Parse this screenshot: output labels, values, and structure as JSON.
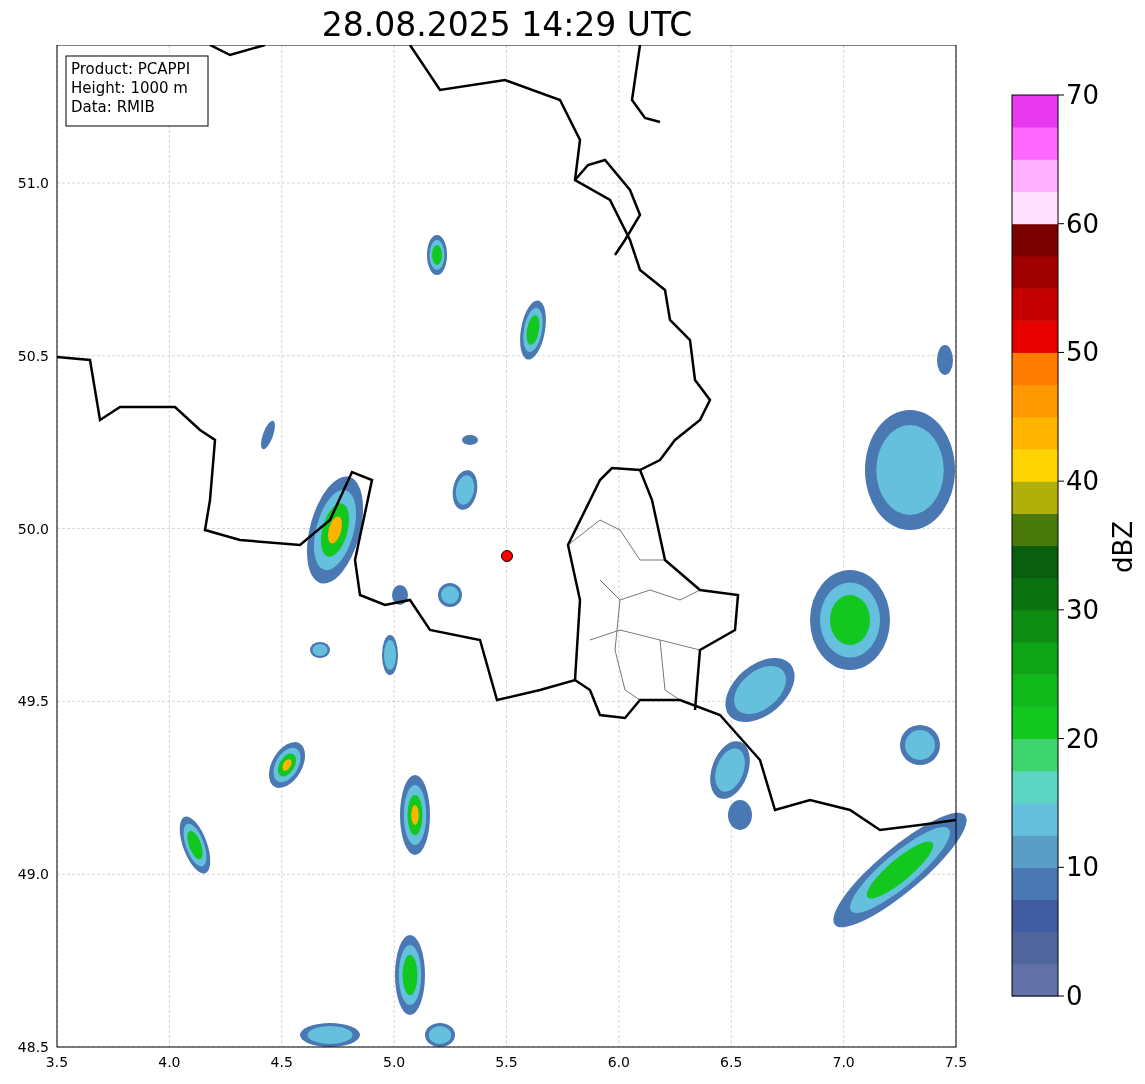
{
  "title": "28.08.2025 14:29 UTC",
  "info_box": [
    "Product: PCAPPI",
    "Height: 1000 m",
    "Data: RMIB"
  ],
  "y_ticks": [
    "51.0",
    "50.5",
    "50.0",
    "49.5",
    "49.0",
    "48.5"
  ],
  "x_ticks": [
    "3.5",
    "4.0",
    "4.5",
    "5.0",
    "5.5",
    "6.0",
    "6.5",
    "7.0",
    "7.5"
  ],
  "colorbar": {
    "label": "dBZ",
    "ticks": [
      "70",
      "60",
      "50",
      "40",
      "30",
      "20",
      "10",
      "0"
    ],
    "segments": [
      {
        "color": "#6272a8"
      },
      {
        "color": "#52669e"
      },
      {
        "color": "#425ca2"
      },
      {
        "color": "#4a78b2"
      },
      {
        "color": "#5a9ec6"
      },
      {
        "color": "#64c0dc"
      },
      {
        "color": "#5cd6c2"
      },
      {
        "color": "#3ed46e"
      },
      {
        "color": "#12c81e"
      },
      {
        "color": "#10b81a"
      },
      {
        "color": "#0ea416"
      },
      {
        "color": "#0e8c14"
      },
      {
        "color": "#0b7210"
      },
      {
        "color": "#0a5e0e"
      },
      {
        "color": "#4a7a0c"
      },
      {
        "color": "#b0b00a"
      },
      {
        "color": "#ffd400"
      },
      {
        "color": "#ffb400"
      },
      {
        "color": "#ff9800"
      },
      {
        "color": "#ff7c00"
      },
      {
        "color": "#e60000"
      },
      {
        "color": "#c40000"
      },
      {
        "color": "#a00000"
      },
      {
        "color": "#7a0000"
      },
      {
        "color": "#ffe0ff"
      },
      {
        "color": "#ffb0ff"
      },
      {
        "color": "#ff68ff"
      },
      {
        "color": "#e838f0"
      }
    ]
  }
}
